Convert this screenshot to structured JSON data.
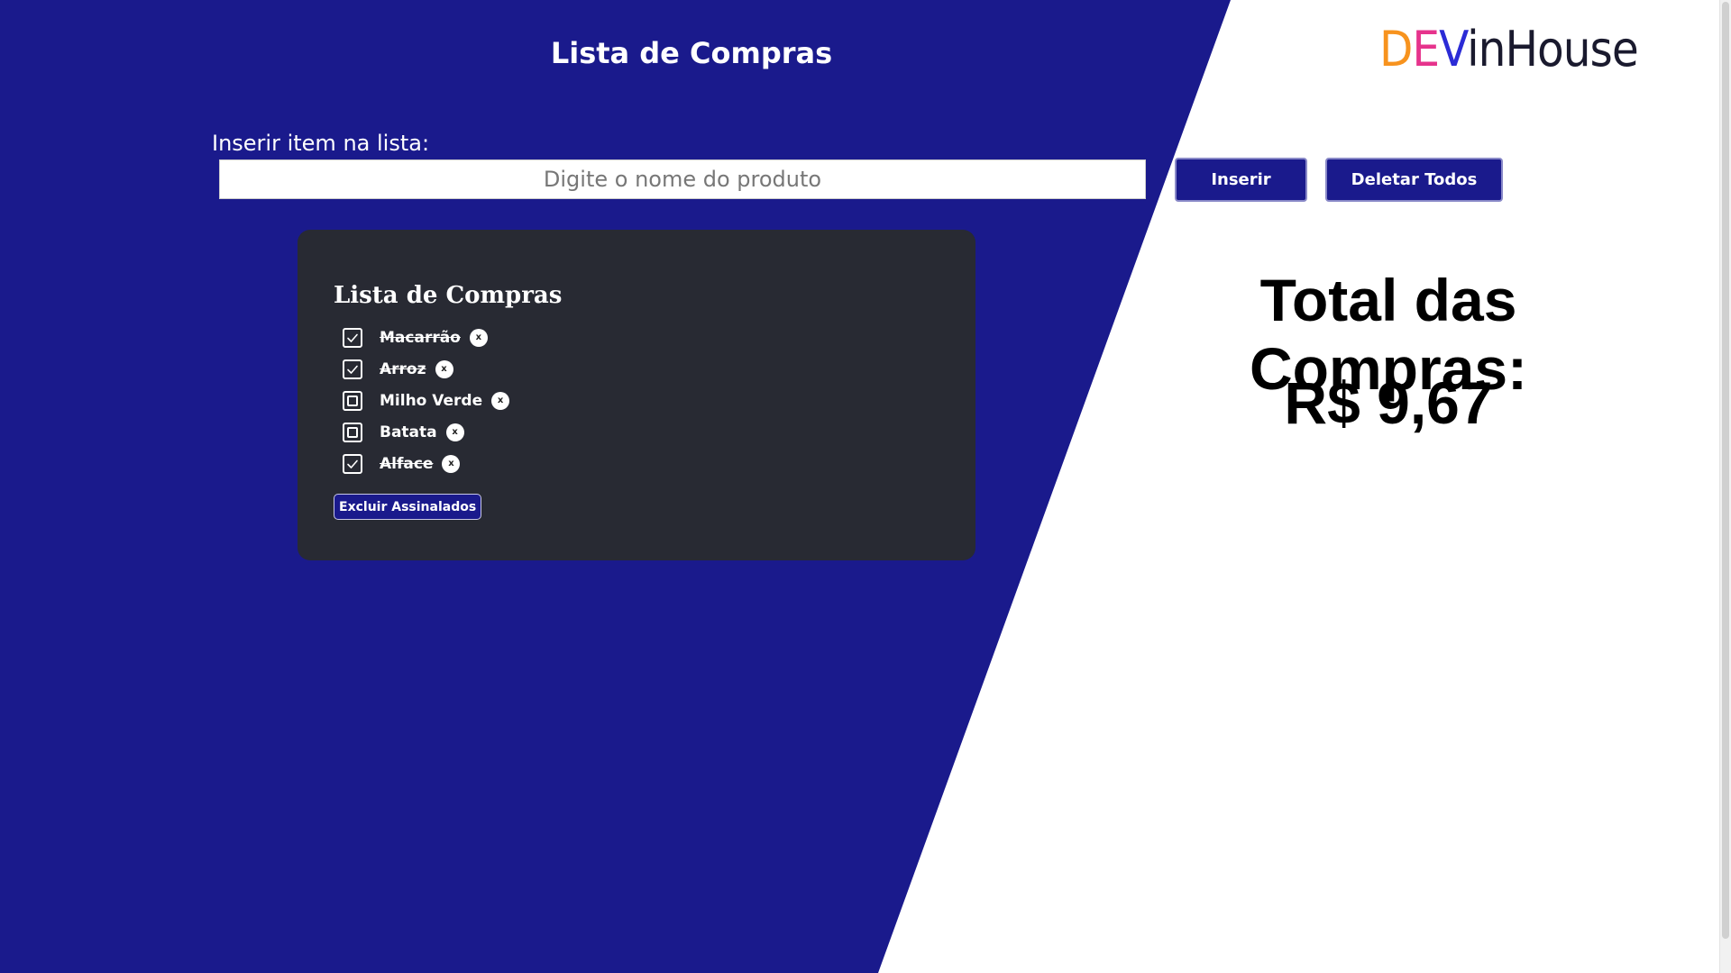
{
  "header": {
    "title": "Lista de Compras",
    "logo": {
      "d": "D",
      "e": "E",
      "v": "V",
      "rest": "inHouse"
    }
  },
  "form": {
    "label": "Inserir item na lista:",
    "placeholder": "Digite o nome do produto",
    "value": "",
    "insert_label": "Inserir",
    "delete_all_label": "Deletar Todos"
  },
  "list": {
    "title": "Lista de Compras",
    "items": [
      {
        "name": "Macarrão",
        "checked": true,
        "remove": "x"
      },
      {
        "name": "Arroz",
        "checked": true,
        "remove": "x"
      },
      {
        "name": "Milho Verde",
        "checked": false,
        "remove": "x"
      },
      {
        "name": "Batata",
        "checked": false,
        "remove": "x"
      },
      {
        "name": "Alface",
        "checked": true,
        "remove": "x"
      }
    ],
    "delete_checked_label": "Excluir Assinalados"
  },
  "total": {
    "label": "Total das Compras:",
    "value": "R$ 9,67"
  },
  "colors": {
    "primary": "#1a1a8c",
    "card": "#282a33",
    "logo_d": "#f7931e",
    "logo_e": "#e6338c",
    "logo_v": "#2b2bd6"
  }
}
